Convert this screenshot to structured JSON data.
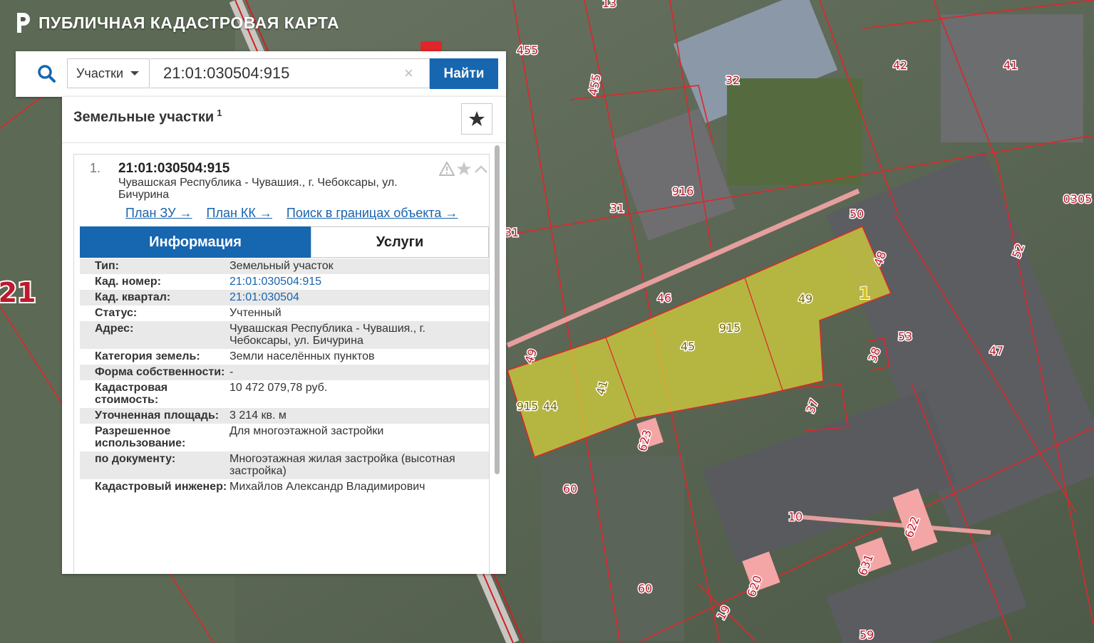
{
  "header": {
    "title": "ПУБЛИЧНАЯ КАДАСТРОВАЯ КАРТА"
  },
  "search": {
    "type": "Участки",
    "value": "21:01:030504:915",
    "clear": "×",
    "button": "Найти"
  },
  "panel": {
    "title": "Земельные участки",
    "count": "1",
    "result": {
      "number": "1.",
      "cad": "21:01:030504:915",
      "address": "Чувашская Республика - Чувашия., г. Чебоксары, ул. Бичурина",
      "links": [
        "План ЗУ →",
        "План КК →",
        "Поиск в границах объекта →"
      ],
      "tabs": {
        "info": "Информация",
        "services": "Услуги"
      },
      "rows": [
        {
          "k": "Тип:",
          "v": "Земельный участок"
        },
        {
          "k": "Кад. номер:",
          "v": "21:01:030504:915"
        },
        {
          "k": "Кад. квартал:",
          "v": "21:01:030504"
        },
        {
          "k": "Статус:",
          "v": "Учтенный"
        },
        {
          "k": "Адрес:",
          "v": "Чувашская Республика - Чувашия., г. Чебоксары, ул. Бичурина"
        },
        {
          "k": "Категория земель:",
          "v": "Земли населённых пунктов"
        },
        {
          "k": "Форма собственности:",
          "v": "-"
        },
        {
          "k": "Кадастровая стоимость:",
          "v": "10 472 079,78 руб."
        },
        {
          "k": "Уточненная площадь:",
          "v": "3 214 кв. м"
        },
        {
          "k": "Разрешенное использование:",
          "v": "Для многоэтажной застройки"
        },
        {
          "k": "по документу:",
          "v": "Многоэтажная жилая застройка (высотная застройка)"
        },
        {
          "k": "Кадастровый инженер:",
          "v": "Михайлов Александр Владимирович"
        }
      ]
    }
  },
  "map": {
    "region_label": "21",
    "labels": [
      "13",
      "455",
      "455",
      "32",
      "42",
      "41",
      "916",
      "31",
      "31",
      "50",
      "48",
      "0305",
      "52",
      "46",
      "49",
      "1",
      "915",
      "45",
      "53",
      "38",
      "47",
      "49",
      "915",
      "44",
      "41",
      "37",
      "623",
      "60",
      "10",
      "622",
      "631",
      "60",
      "620",
      "19",
      "59"
    ]
  },
  "colors": {
    "accent": "#1766b0",
    "link": "#1a63ad",
    "parcel": "#d8d53a",
    "boundary": "#e0262a"
  }
}
